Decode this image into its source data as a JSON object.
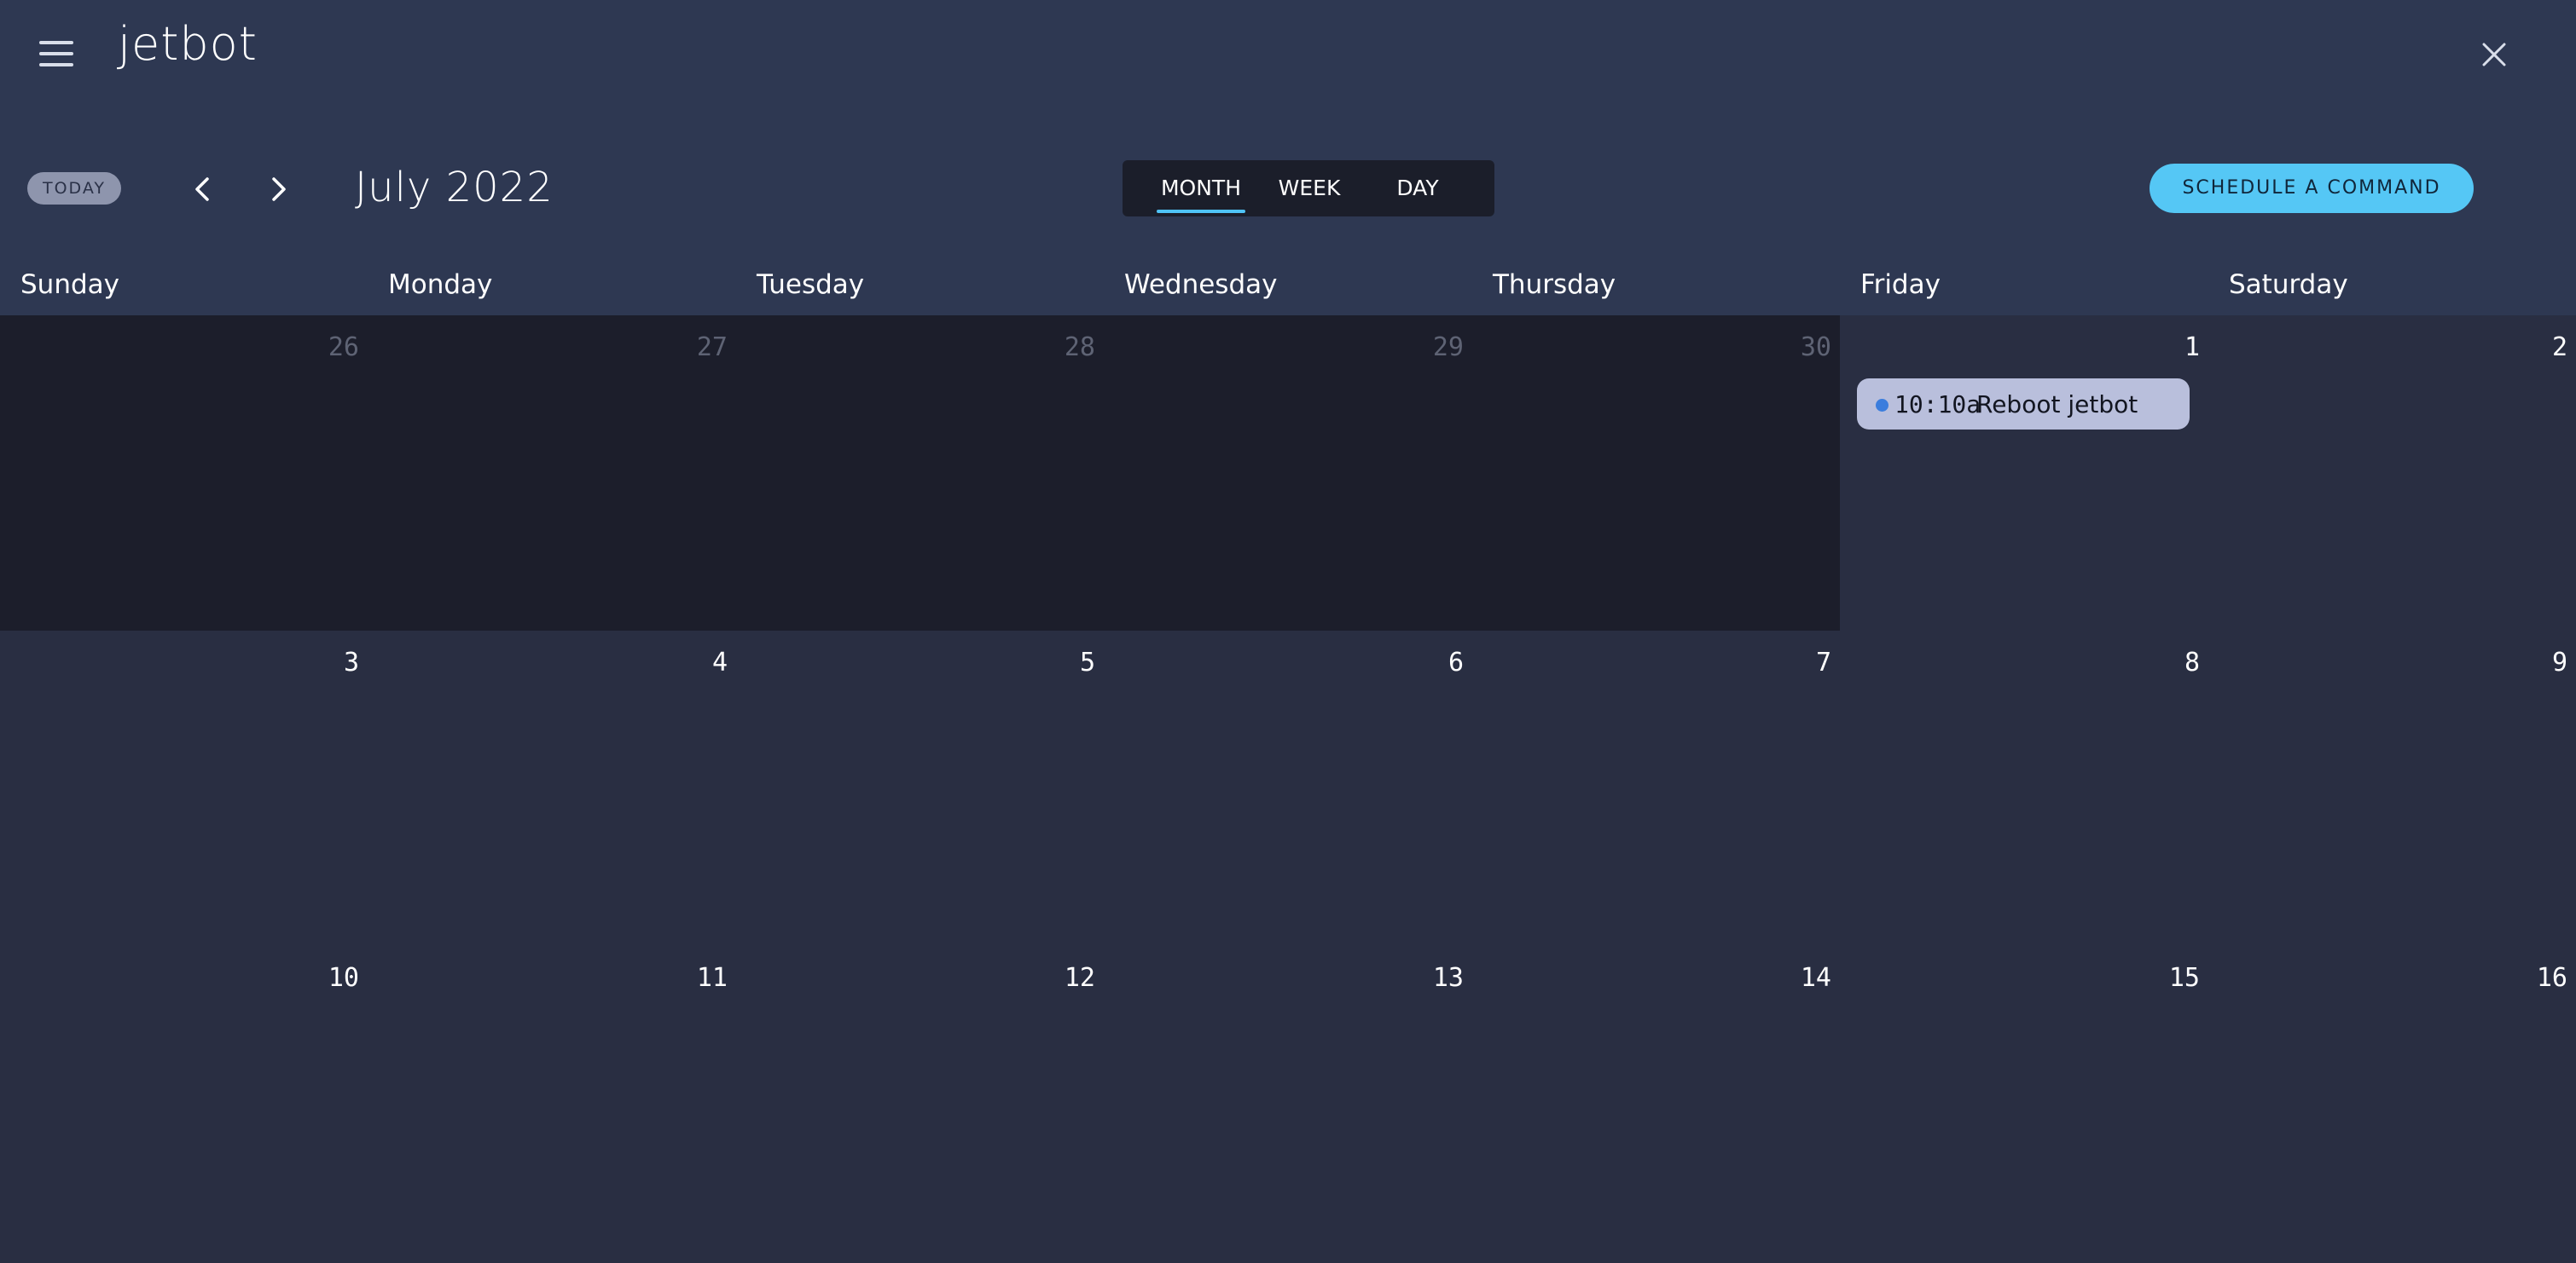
{
  "header": {
    "app_title": "jetbot"
  },
  "toolbar": {
    "today_label": "TODAY",
    "month_label": "July 2022",
    "views": [
      "MONTH",
      "WEEK",
      "DAY"
    ],
    "active_view": "MONTH",
    "schedule_label": "SCHEDULE A COMMAND"
  },
  "weekdays": [
    "Sunday",
    "Monday",
    "Tuesday",
    "Wednesday",
    "Thursday",
    "Friday",
    "Saturday"
  ],
  "weeks": [
    [
      {
        "day": "26",
        "outside": true
      },
      {
        "day": "27",
        "outside": true
      },
      {
        "day": "28",
        "outside": true
      },
      {
        "day": "29",
        "outside": true
      },
      {
        "day": "30",
        "outside": true
      },
      {
        "day": "1",
        "outside": false
      },
      {
        "day": "2",
        "outside": false
      }
    ],
    [
      {
        "day": "3",
        "outside": false
      },
      {
        "day": "4",
        "outside": false
      },
      {
        "day": "5",
        "outside": false
      },
      {
        "day": "6",
        "outside": false
      },
      {
        "day": "7",
        "outside": false
      },
      {
        "day": "8",
        "outside": false
      },
      {
        "day": "9",
        "outside": false
      }
    ],
    [
      {
        "day": "10",
        "outside": false
      },
      {
        "day": "11",
        "outside": false
      },
      {
        "day": "12",
        "outside": false
      },
      {
        "day": "13",
        "outside": false
      },
      {
        "day": "14",
        "outside": false
      },
      {
        "day": "15",
        "outside": false
      },
      {
        "day": "16",
        "outside": false
      }
    ]
  ],
  "events": [
    {
      "day": "1",
      "time": "10:10a",
      "title": "Reboot jetbot"
    }
  ],
  "colors": {
    "accent": "#55c7f5",
    "event_dot": "#3b7ddd",
    "event_bg": "#b9bfdc"
  }
}
